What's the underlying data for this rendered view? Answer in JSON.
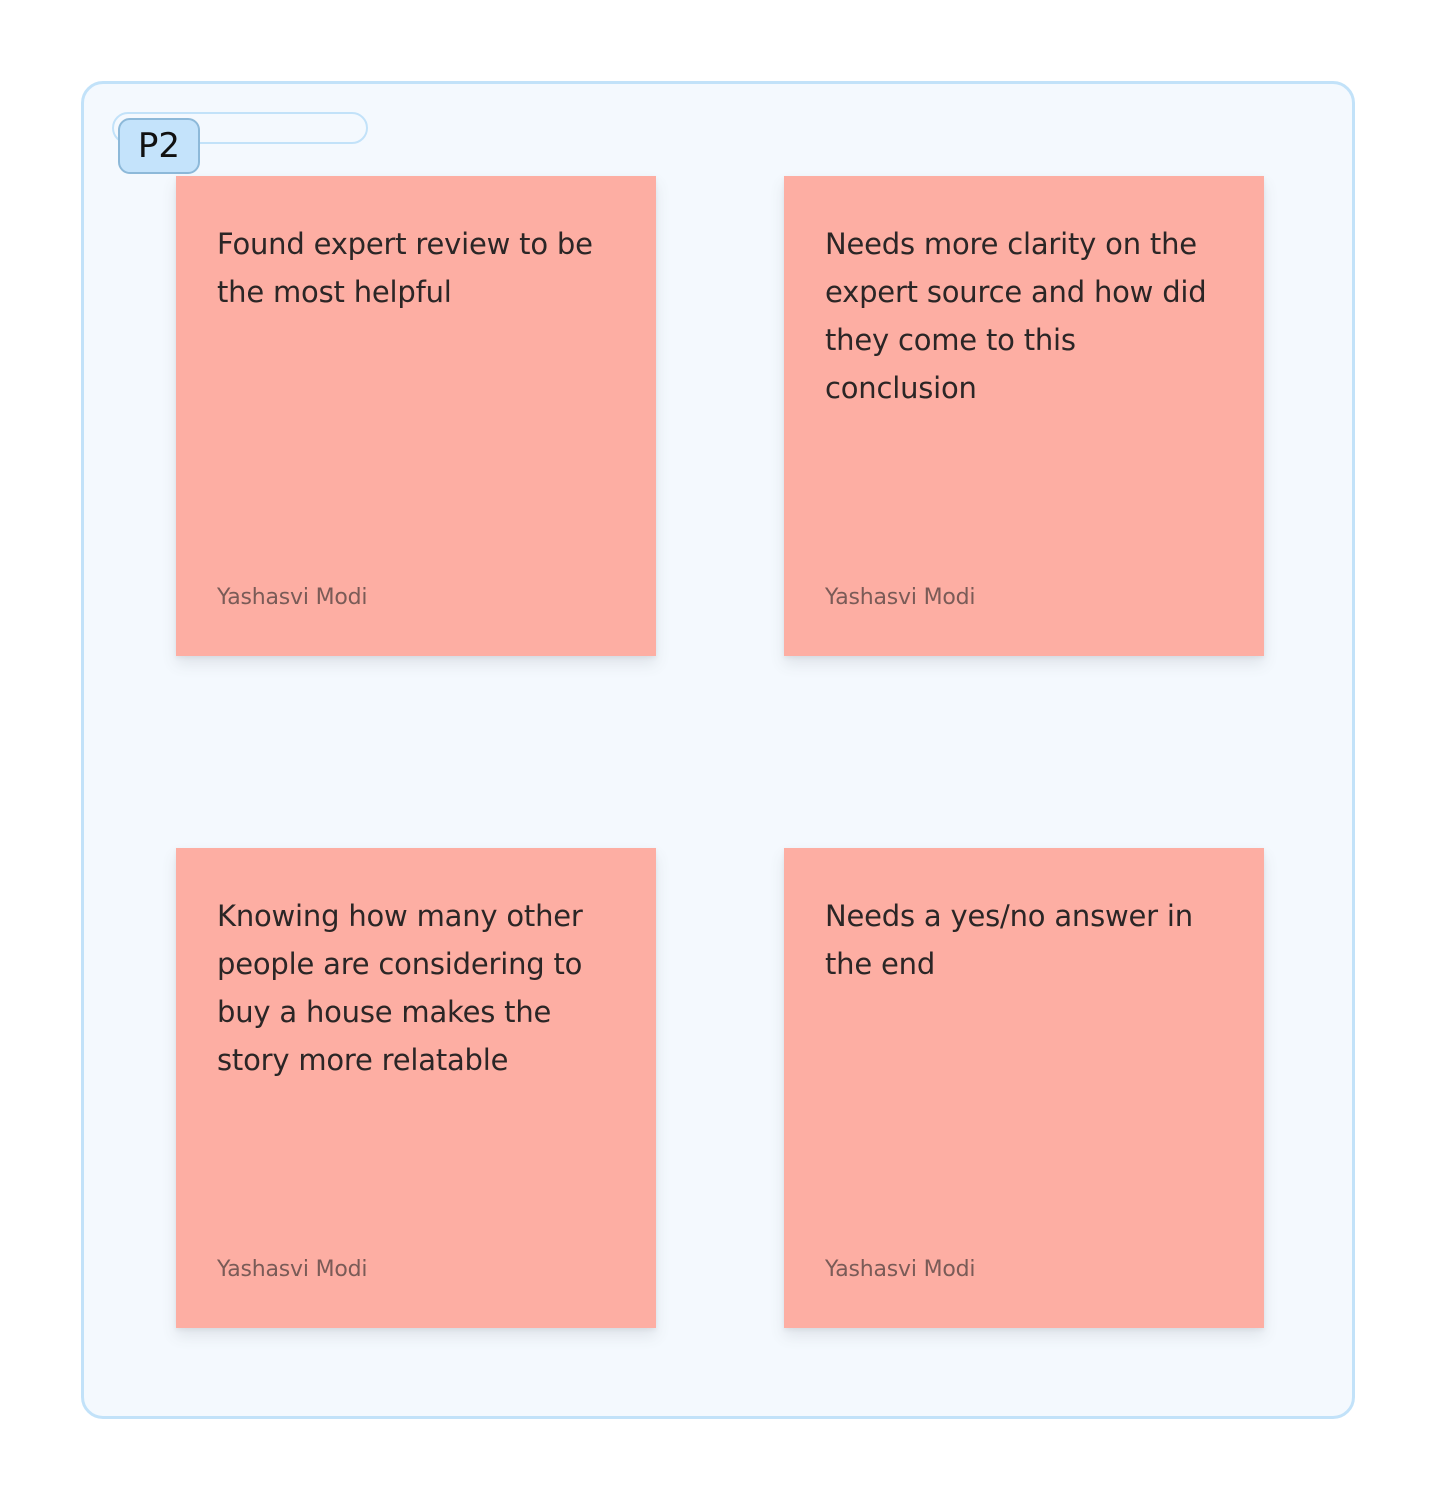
{
  "section": {
    "label": "P2",
    "title_value": ""
  },
  "colors": {
    "board_background": "#f4f9fe",
    "board_border": "#c2e2f9",
    "label_background": "#c4e3fb",
    "sticky_background": "#fdaea3"
  },
  "notes": [
    {
      "text": "Found expert review to be the most helpful",
      "author": "Yashasvi Modi"
    },
    {
      "text": "Needs more clarity on the expert source and how did they come to this conclusion",
      "author": "Yashasvi Modi"
    },
    {
      "text": "Knowing how many other people are considering to buy a house makes the story more relatable",
      "author": "Yashasvi Modi"
    },
    {
      "text": "Needs a yes/no answer in the end",
      "author": "Yashasvi Modi"
    }
  ]
}
